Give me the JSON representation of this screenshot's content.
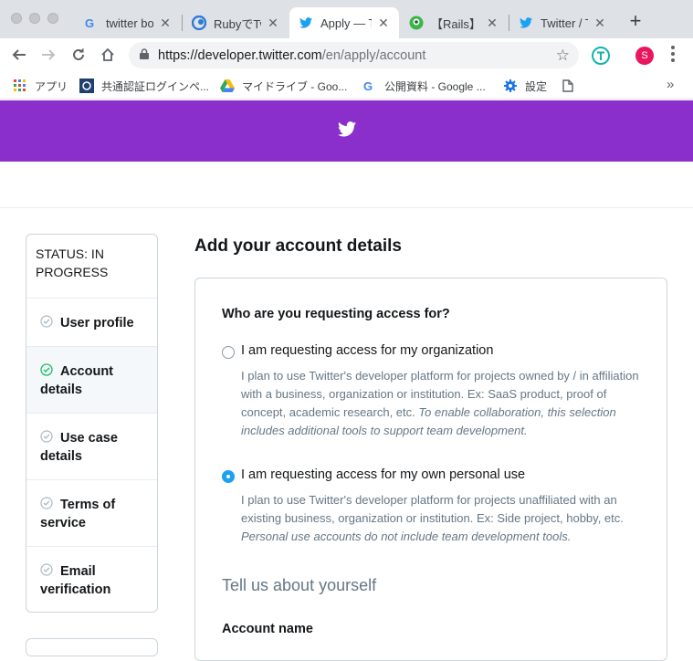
{
  "browser": {
    "tabs": [
      {
        "title": "twitter bo",
        "icon": "google-icon"
      },
      {
        "title": "RubyでTw",
        "icon": "blue-bird-logo-icon"
      },
      {
        "title": "Apply — T",
        "icon": "twitter-icon"
      },
      {
        "title": "【Rails】T",
        "icon": "green-avatar-icon"
      },
      {
        "title": "Twitter / T",
        "icon": "twitter-icon"
      }
    ],
    "url_host": "https://developer.twitter.com",
    "url_path": "/en/apply/account",
    "profile_initial": "S",
    "bookmarks": [
      {
        "label": "アプリ",
        "icon": "apps-grid-icon"
      },
      {
        "label": "共通認証ログインペ...",
        "icon": "site-icon"
      },
      {
        "label": "マイドライブ - Goo...",
        "icon": "drive-icon"
      },
      {
        "label": "公開資料 - Google ...",
        "icon": "google-icon"
      },
      {
        "label": "設定",
        "icon": "gear-icon"
      },
      {
        "label": "",
        "icon": "document-icon"
      }
    ]
  },
  "sidebar": {
    "status": "STATUS: IN PROGRESS",
    "steps": [
      {
        "label": "User profile",
        "state": "done"
      },
      {
        "label": "Account details",
        "state": "active"
      },
      {
        "label": "Use case details",
        "state": "todo"
      },
      {
        "label": "Terms of service",
        "state": "todo"
      },
      {
        "label": "Email verification",
        "state": "todo"
      }
    ]
  },
  "main": {
    "title": "Add your account details",
    "question": "Who are you requesting access for?",
    "options": [
      {
        "label": "I am requesting access for my organization",
        "desc": "I plan to use Twitter's developer platform for projects owned by / in affiliation with a business, organization or institution. Ex: SaaS product, proof of concept, academic research, etc.",
        "desc_italic": "To enable collaboration, this selection includes additional tools to support team development.",
        "selected": false
      },
      {
        "label": "I am requesting access for my own personal use",
        "desc": "I plan to use Twitter's developer platform for projects unaffiliated with an existing business, organization or institution. Ex: Side project, hobby, etc.",
        "desc_italic": "Personal use accounts do not include team development tools.",
        "selected": true
      }
    ],
    "section_title": "Tell us about yourself",
    "account_name_label": "Account name"
  },
  "colors": {
    "banner": "#8a2fcc",
    "accent": "#1da1f2",
    "check": "#17bf63"
  }
}
